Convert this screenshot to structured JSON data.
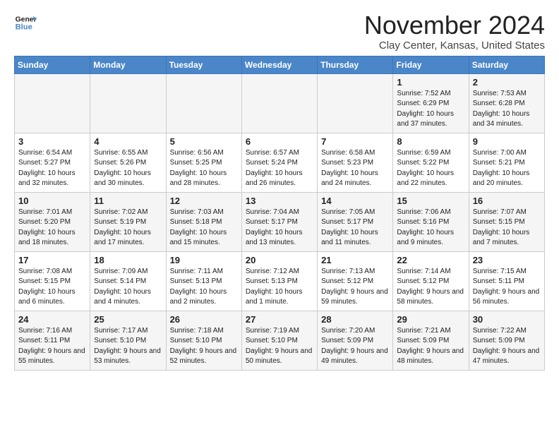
{
  "header": {
    "logo_line1": "General",
    "logo_line2": "Blue",
    "month": "November 2024",
    "location": "Clay Center, Kansas, United States"
  },
  "weekdays": [
    "Sunday",
    "Monday",
    "Tuesday",
    "Wednesday",
    "Thursday",
    "Friday",
    "Saturday"
  ],
  "weeks": [
    [
      {
        "day": "",
        "info": ""
      },
      {
        "day": "",
        "info": ""
      },
      {
        "day": "",
        "info": ""
      },
      {
        "day": "",
        "info": ""
      },
      {
        "day": "",
        "info": ""
      },
      {
        "day": "1",
        "info": "Sunrise: 7:52 AM\nSunset: 6:29 PM\nDaylight: 10 hours and 37 minutes."
      },
      {
        "day": "2",
        "info": "Sunrise: 7:53 AM\nSunset: 6:28 PM\nDaylight: 10 hours and 34 minutes."
      }
    ],
    [
      {
        "day": "3",
        "info": "Sunrise: 6:54 AM\nSunset: 5:27 PM\nDaylight: 10 hours and 32 minutes."
      },
      {
        "day": "4",
        "info": "Sunrise: 6:55 AM\nSunset: 5:26 PM\nDaylight: 10 hours and 30 minutes."
      },
      {
        "day": "5",
        "info": "Sunrise: 6:56 AM\nSunset: 5:25 PM\nDaylight: 10 hours and 28 minutes."
      },
      {
        "day": "6",
        "info": "Sunrise: 6:57 AM\nSunset: 5:24 PM\nDaylight: 10 hours and 26 minutes."
      },
      {
        "day": "7",
        "info": "Sunrise: 6:58 AM\nSunset: 5:23 PM\nDaylight: 10 hours and 24 minutes."
      },
      {
        "day": "8",
        "info": "Sunrise: 6:59 AM\nSunset: 5:22 PM\nDaylight: 10 hours and 22 minutes."
      },
      {
        "day": "9",
        "info": "Sunrise: 7:00 AM\nSunset: 5:21 PM\nDaylight: 10 hours and 20 minutes."
      }
    ],
    [
      {
        "day": "10",
        "info": "Sunrise: 7:01 AM\nSunset: 5:20 PM\nDaylight: 10 hours and 18 minutes."
      },
      {
        "day": "11",
        "info": "Sunrise: 7:02 AM\nSunset: 5:19 PM\nDaylight: 10 hours and 17 minutes."
      },
      {
        "day": "12",
        "info": "Sunrise: 7:03 AM\nSunset: 5:18 PM\nDaylight: 10 hours and 15 minutes."
      },
      {
        "day": "13",
        "info": "Sunrise: 7:04 AM\nSunset: 5:17 PM\nDaylight: 10 hours and 13 minutes."
      },
      {
        "day": "14",
        "info": "Sunrise: 7:05 AM\nSunset: 5:17 PM\nDaylight: 10 hours and 11 minutes."
      },
      {
        "day": "15",
        "info": "Sunrise: 7:06 AM\nSunset: 5:16 PM\nDaylight: 10 hours and 9 minutes."
      },
      {
        "day": "16",
        "info": "Sunrise: 7:07 AM\nSunset: 5:15 PM\nDaylight: 10 hours and 7 minutes."
      }
    ],
    [
      {
        "day": "17",
        "info": "Sunrise: 7:08 AM\nSunset: 5:15 PM\nDaylight: 10 hours and 6 minutes."
      },
      {
        "day": "18",
        "info": "Sunrise: 7:09 AM\nSunset: 5:14 PM\nDaylight: 10 hours and 4 minutes."
      },
      {
        "day": "19",
        "info": "Sunrise: 7:11 AM\nSunset: 5:13 PM\nDaylight: 10 hours and 2 minutes."
      },
      {
        "day": "20",
        "info": "Sunrise: 7:12 AM\nSunset: 5:13 PM\nDaylight: 10 hours and 1 minute."
      },
      {
        "day": "21",
        "info": "Sunrise: 7:13 AM\nSunset: 5:12 PM\nDaylight: 9 hours and 59 minutes."
      },
      {
        "day": "22",
        "info": "Sunrise: 7:14 AM\nSunset: 5:12 PM\nDaylight: 9 hours and 58 minutes."
      },
      {
        "day": "23",
        "info": "Sunrise: 7:15 AM\nSunset: 5:11 PM\nDaylight: 9 hours and 56 minutes."
      }
    ],
    [
      {
        "day": "24",
        "info": "Sunrise: 7:16 AM\nSunset: 5:11 PM\nDaylight: 9 hours and 55 minutes."
      },
      {
        "day": "25",
        "info": "Sunrise: 7:17 AM\nSunset: 5:10 PM\nDaylight: 9 hours and 53 minutes."
      },
      {
        "day": "26",
        "info": "Sunrise: 7:18 AM\nSunset: 5:10 PM\nDaylight: 9 hours and 52 minutes."
      },
      {
        "day": "27",
        "info": "Sunrise: 7:19 AM\nSunset: 5:10 PM\nDaylight: 9 hours and 50 minutes."
      },
      {
        "day": "28",
        "info": "Sunrise: 7:20 AM\nSunset: 5:09 PM\nDaylight: 9 hours and 49 minutes."
      },
      {
        "day": "29",
        "info": "Sunrise: 7:21 AM\nSunset: 5:09 PM\nDaylight: 9 hours and 48 minutes."
      },
      {
        "day": "30",
        "info": "Sunrise: 7:22 AM\nSunset: 5:09 PM\nDaylight: 9 hours and 47 minutes."
      }
    ]
  ]
}
